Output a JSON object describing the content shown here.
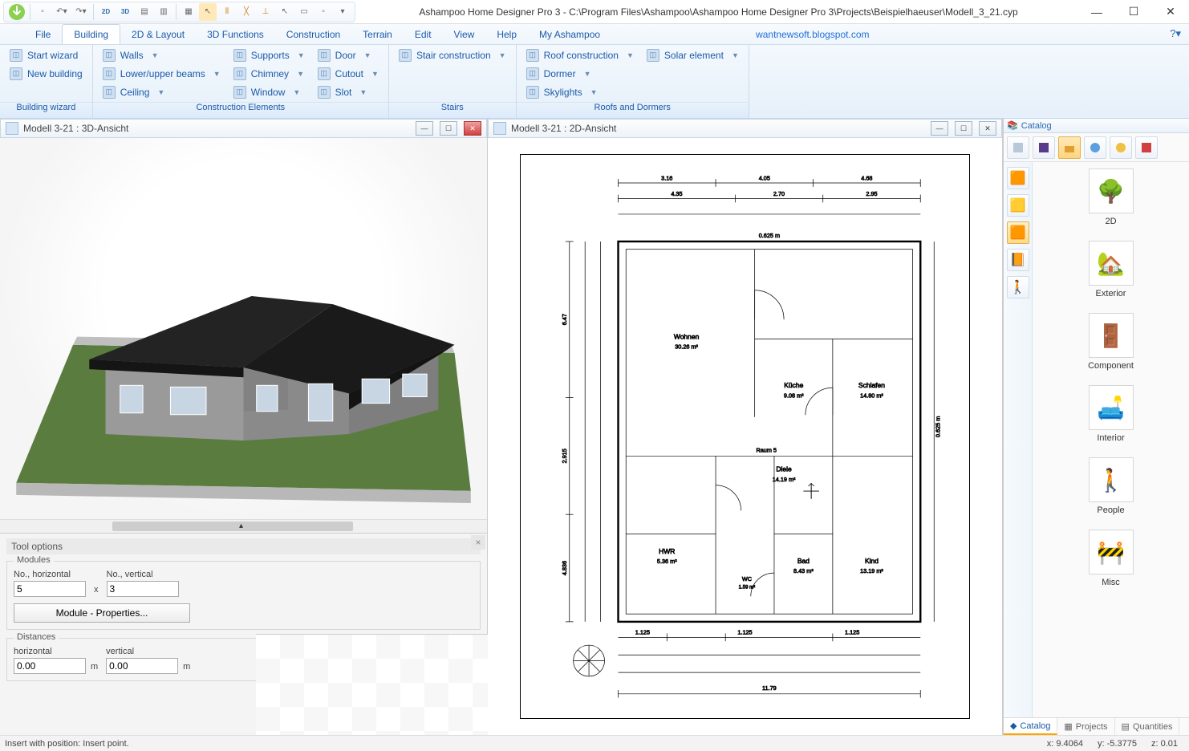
{
  "app_title": "Ashampoo Home Designer Pro 3 - C:\\Program Files\\Ashampoo\\Ashampoo Home Designer Pro 3\\Projects\\Beispielhaeuser\\Modell_3_21.cyp",
  "menubar": {
    "tabs": [
      "File",
      "Building",
      "2D & Layout",
      "3D Functions",
      "Construction",
      "Terrain",
      "Edit",
      "View",
      "Help",
      "My Ashampoo"
    ],
    "active": "Building",
    "link": "wantnewsoft.blogspot.com"
  },
  "ribbon": {
    "groups": [
      {
        "title": "Building wizard",
        "cols": [
          [
            {
              "label": "Start wizard",
              "dd": false
            },
            {
              "label": "New building",
              "dd": false
            }
          ]
        ]
      },
      {
        "title": "Construction Elements",
        "cols": [
          [
            {
              "label": "Walls",
              "dd": true
            },
            {
              "label": "Lower/upper beams",
              "dd": true
            },
            {
              "label": "Ceiling",
              "dd": true
            }
          ],
          [
            {
              "label": "Supports",
              "dd": true
            },
            {
              "label": "Chimney",
              "dd": true
            },
            {
              "label": "Window",
              "dd": true
            }
          ],
          [
            {
              "label": "Door",
              "dd": true
            },
            {
              "label": "Cutout",
              "dd": true
            },
            {
              "label": "Slot",
              "dd": true
            }
          ]
        ]
      },
      {
        "title": "Stairs",
        "cols": [
          [
            {
              "label": "Stair construction",
              "dd": true
            }
          ]
        ]
      },
      {
        "title": "Roofs and Dormers",
        "cols": [
          [
            {
              "label": "Roof construction",
              "dd": true
            },
            {
              "label": "Dormer",
              "dd": true
            },
            {
              "label": "Skylights",
              "dd": true
            }
          ],
          [
            {
              "label": "Solar element",
              "dd": true
            }
          ]
        ]
      }
    ]
  },
  "views": {
    "view3d_title": "Modell 3-21 : 3D-Ansicht",
    "view2d_title": "Modell 3-21 : 2D-Ansicht"
  },
  "tool_options": {
    "title": "Tool options",
    "modules_label": "Modules",
    "no_horizontal_label": "No., horizontal",
    "no_vertical_label": "No., vertical",
    "no_horizontal": "5",
    "no_vertical": "3",
    "x_label": "x",
    "properties_btn": "Module - Properties...",
    "distances_label": "Distances",
    "dist_h_label": "horizontal",
    "dist_v_label": "vertical",
    "dist_h": "0.00",
    "dist_v": "0.00",
    "unit": "m"
  },
  "catalog": {
    "title": "Catalog",
    "items": [
      "2D",
      "Exterior",
      "Component",
      "Interior",
      "People",
      "Misc"
    ],
    "tabs": [
      "Catalog",
      "Projects",
      "Quantities"
    ],
    "active_tab": "Catalog"
  },
  "statusbar": {
    "hint": "Insert with position: Insert point.",
    "x_label": "x:",
    "x": "9.4064",
    "y_label": "y:",
    "y": "-5.3775",
    "z_label": "z:",
    "z": "0.01"
  },
  "floorplan": {
    "rooms": [
      {
        "name": "Wohnen",
        "area": "30.26 m²"
      },
      {
        "name": "Küche",
        "area": "9.08 m²"
      },
      {
        "name": "Schlafen",
        "area": "14.80 m²"
      },
      {
        "name": "Diele",
        "area": "14.19 m²"
      },
      {
        "name": "HWR",
        "area": "5.36 m²"
      },
      {
        "name": "Bad",
        "area": "8.43 m²"
      },
      {
        "name": "Kind",
        "area": "13.19 m²"
      }
    ],
    "top_dims": [
      "3.16",
      "4.05",
      "4.68"
    ],
    "top_dims2": [
      "4.35",
      "2.70",
      "2.95"
    ],
    "left_dims": [
      "6.47",
      "2.915",
      "4.836"
    ],
    "bottom_dims": [
      "1.125",
      "1.125",
      "1.125"
    ],
    "overall_width": "11.79",
    "overall_top": "0.625 m",
    "right_dim": "0.625 m",
    "wc_label": "WC",
    "wc_area": "1.59 m²",
    "raum_label": "Raum 5"
  }
}
